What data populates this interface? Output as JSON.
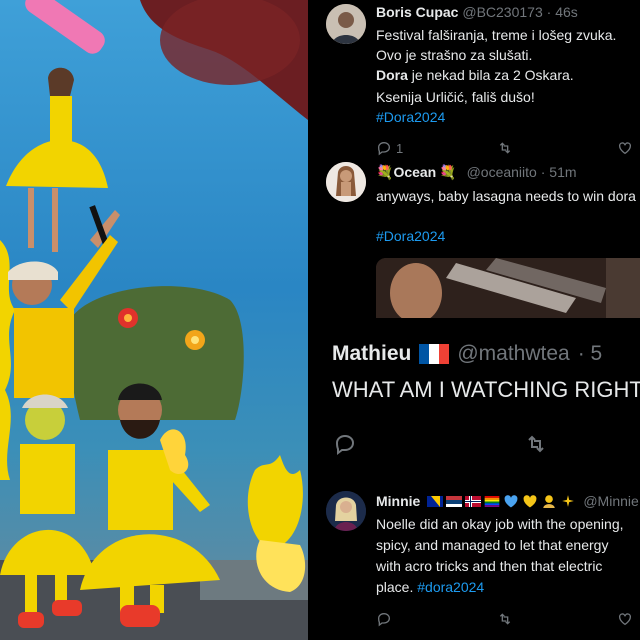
{
  "tweets": [
    {
      "name": "Boris Cupac",
      "handle": "@BC230173",
      "time": "· 46s",
      "lines": [
        {
          "text": "Festival falširanja, treme i lošeg zvuka."
        },
        {
          "text": "Ovo je strašno za slušati."
        },
        {
          "bold": "Dora",
          "text": " je nekad bila za 2 Oskara."
        },
        {
          "text": "Ksenija Urličić, fališ dušo!"
        }
      ],
      "hashtag": "#Dora2024",
      "reply_count": "1"
    },
    {
      "name_prefix": "💐",
      "name": "Ocean",
      "name_suffix": "💐",
      "handle": "@oceaniito",
      "time": "· 51m",
      "text": "anyways, baby lasagna needs to win dora",
      "hashtag": "#Dora2024"
    },
    {
      "name": "Mathieu",
      "flag": "fr",
      "handle": "@mathwtea",
      "time": "· 5",
      "text": "WHAT AM I WATCHING RIGHT"
    },
    {
      "name": "Minnie",
      "handle": "@Minnie",
      "lines": [
        "Noelle did an okay job with the opening,",
        "spicy, and managed to let that energy",
        "with acro tricks and then that electric",
        "place."
      ],
      "hashtag": "#dora2024"
    }
  ],
  "colors": {
    "background": "#000000",
    "text": "#e7e9ea",
    "secondary": "#71767b",
    "hashtag": "#1d9bf0",
    "stage_blue": "#2a86c4",
    "costume_yellow": "#f2d400"
  },
  "icons": [
    "reply-icon",
    "retweet-icon",
    "like-icon",
    "flag-fr-icon",
    "flag-ba-icon",
    "flag-rs-icon",
    "flag-no-icon",
    "flag-lgbt-icon",
    "blue-heart-icon",
    "yellow-heart-icon",
    "sparkles-icon",
    "bouquet-icon"
  ]
}
